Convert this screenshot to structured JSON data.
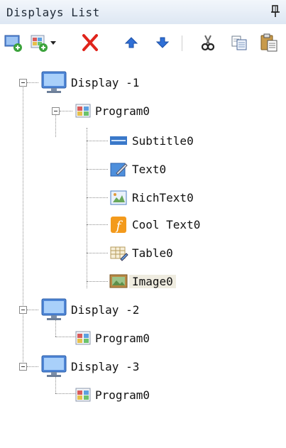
{
  "panel": {
    "title": "Displays List",
    "pin_icon": "pin-icon"
  },
  "toolbar": {
    "buttons": [
      {
        "name": "add-display-button",
        "icon": "add-display-icon"
      },
      {
        "name": "add-program-button",
        "icon": "add-program-dropdown-icon"
      },
      {
        "name": "delete-button",
        "icon": "delete-icon",
        "color": "#e0241b"
      },
      {
        "name": "move-up-button",
        "icon": "arrow-up-icon",
        "color": "#2f6fd6"
      },
      {
        "name": "move-down-button",
        "icon": "arrow-down-icon",
        "color": "#2f6fd6"
      },
      {
        "name": "cut-button",
        "icon": "scissors-icon"
      },
      {
        "name": "copy-button",
        "icon": "copy-icon"
      },
      {
        "name": "paste-button",
        "icon": "paste-icon"
      }
    ]
  },
  "tree": {
    "displays": [
      {
        "label": "Display -1",
        "program": {
          "label": "Program0",
          "items": [
            {
              "label": "Subtitle0",
              "icon": "subtitle-icon"
            },
            {
              "label": "Text0",
              "icon": "text-icon"
            },
            {
              "label": "RichText0",
              "icon": "richtext-icon"
            },
            {
              "label": "Cool Text0",
              "icon": "cool-text-icon"
            },
            {
              "label": "Table0",
              "icon": "table-icon"
            },
            {
              "label": "Image0",
              "icon": "image-icon",
              "selected": true
            }
          ]
        }
      },
      {
        "label": "Display -2",
        "program": {
          "label": "Program0"
        }
      },
      {
        "label": "Display -3",
        "program": {
          "label": "Program0"
        }
      }
    ]
  }
}
